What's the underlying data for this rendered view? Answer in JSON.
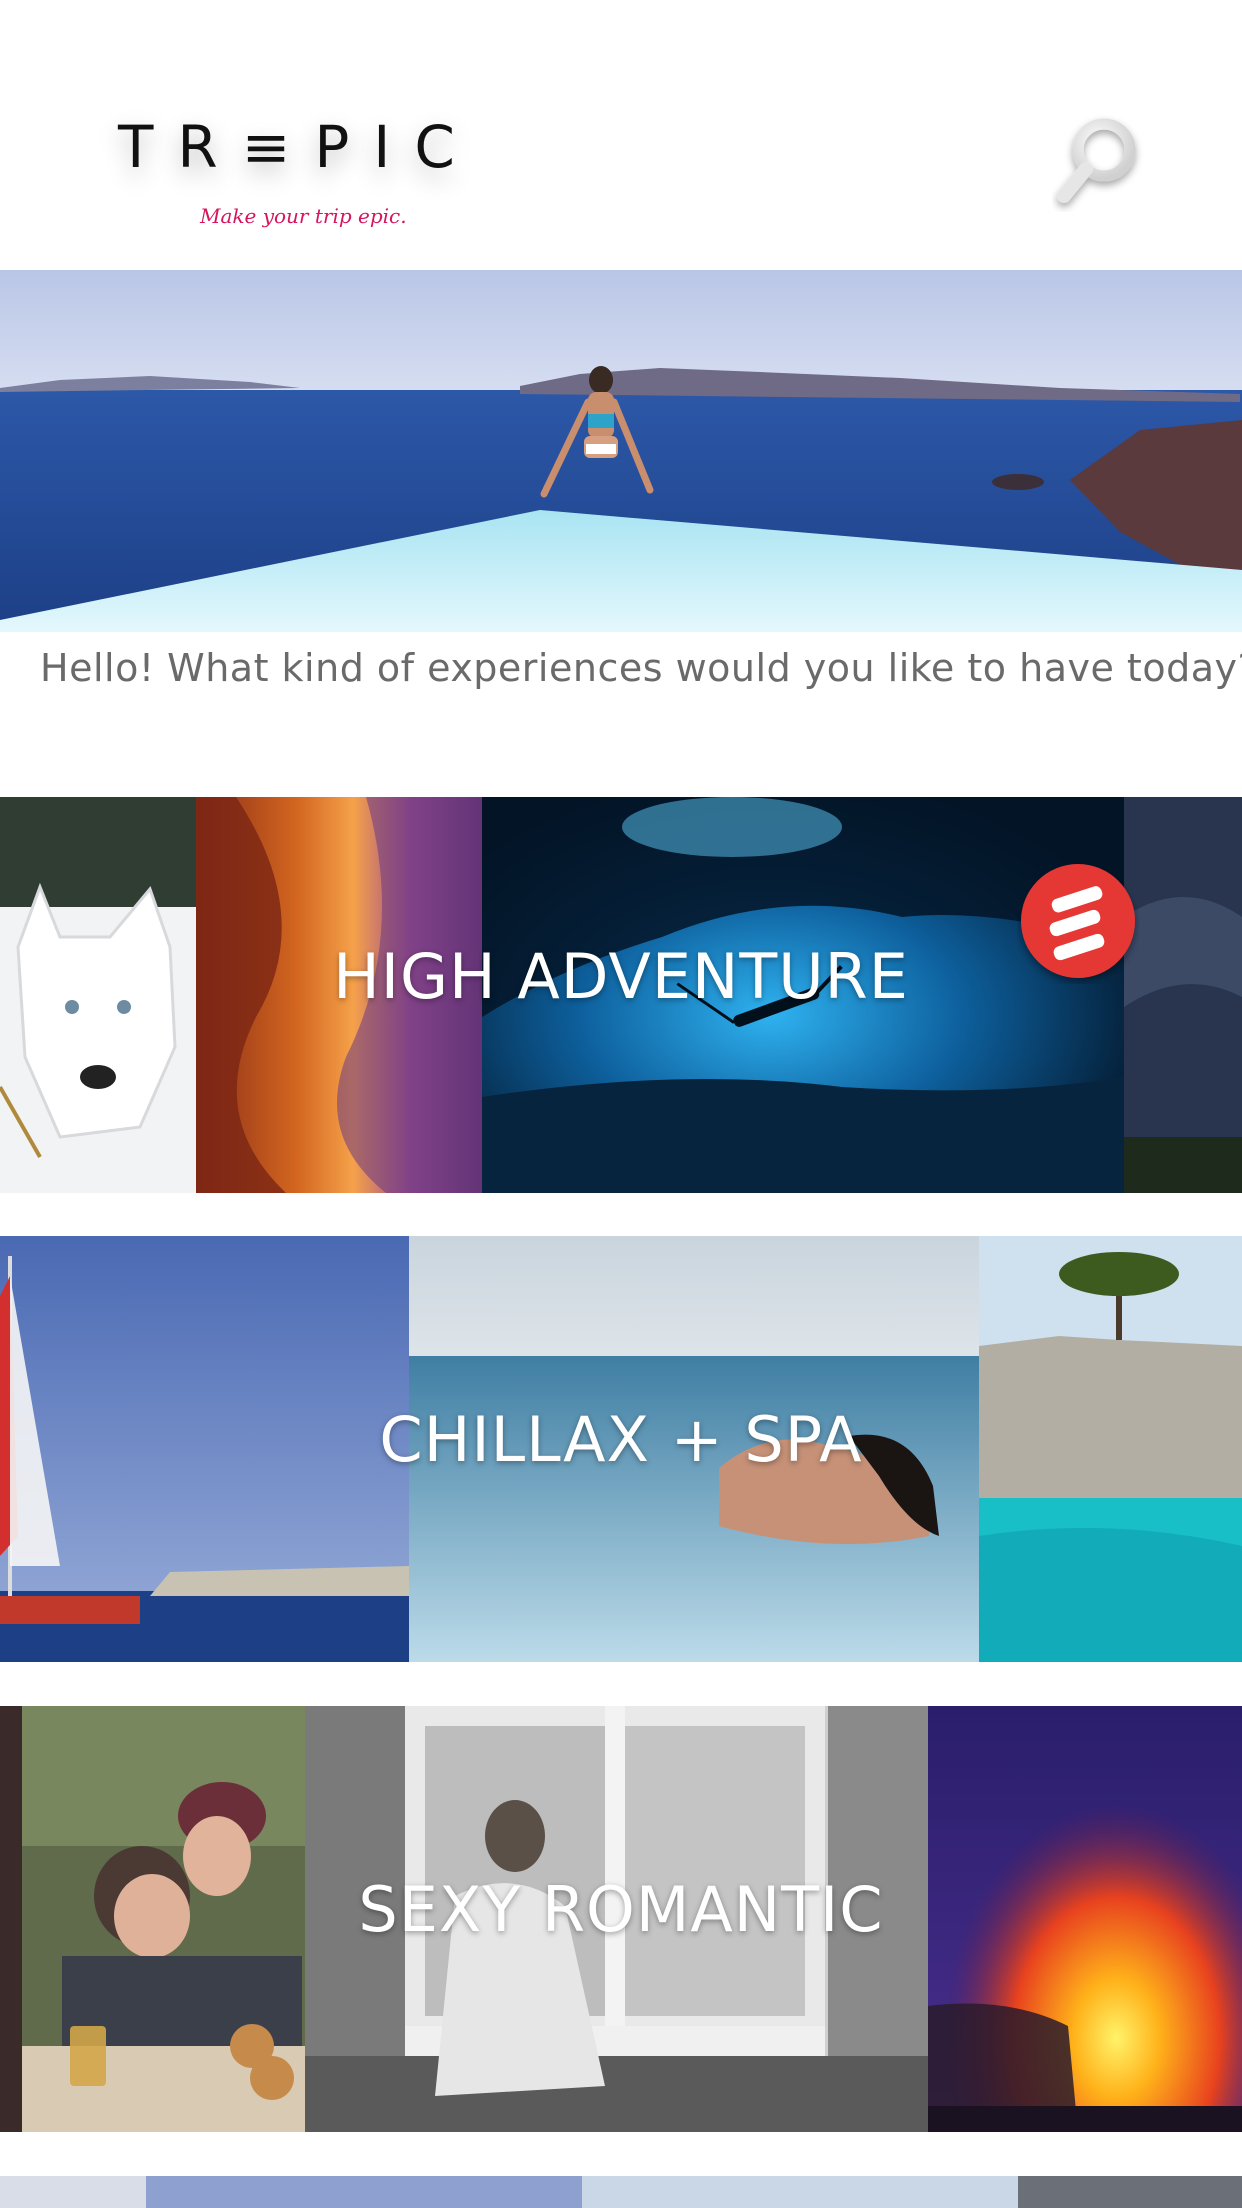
{
  "header": {
    "logo_text": "TR≡PIC",
    "tagline": "Make your trip epic.",
    "search_icon": "search-icon"
  },
  "hero": {
    "image": "woman-in-infinity-pool-over-sea-photo"
  },
  "greeting": "Hello! What kind of experiences would you like to have today?",
  "categories": [
    {
      "label": "HIGH ADVENTURE",
      "images": [
        "husky-dog-in-snow-photo",
        "slot-canyon-photo",
        "underwater-cave-diver-photo",
        "stormy-sky-photo"
      ]
    },
    {
      "label": "CHILLAX + SPA",
      "images": [
        "sailboat-at-sea-photo",
        "woman-floating-in-pool-photo",
        "cliff-turquoise-water-photo"
      ]
    },
    {
      "label": "SEXY ROMANTIC",
      "images": [
        "couple-kissing-outdoors-photo",
        "woman-by-window-bw-photo",
        "lava-glow-night-photo"
      ]
    }
  ],
  "badge_icon": "trepic-logo-badge-icon",
  "colors": {
    "brand_pink": "#d6155e",
    "badge_red": "#e53935",
    "greeting_gray": "#6a6a6a"
  }
}
